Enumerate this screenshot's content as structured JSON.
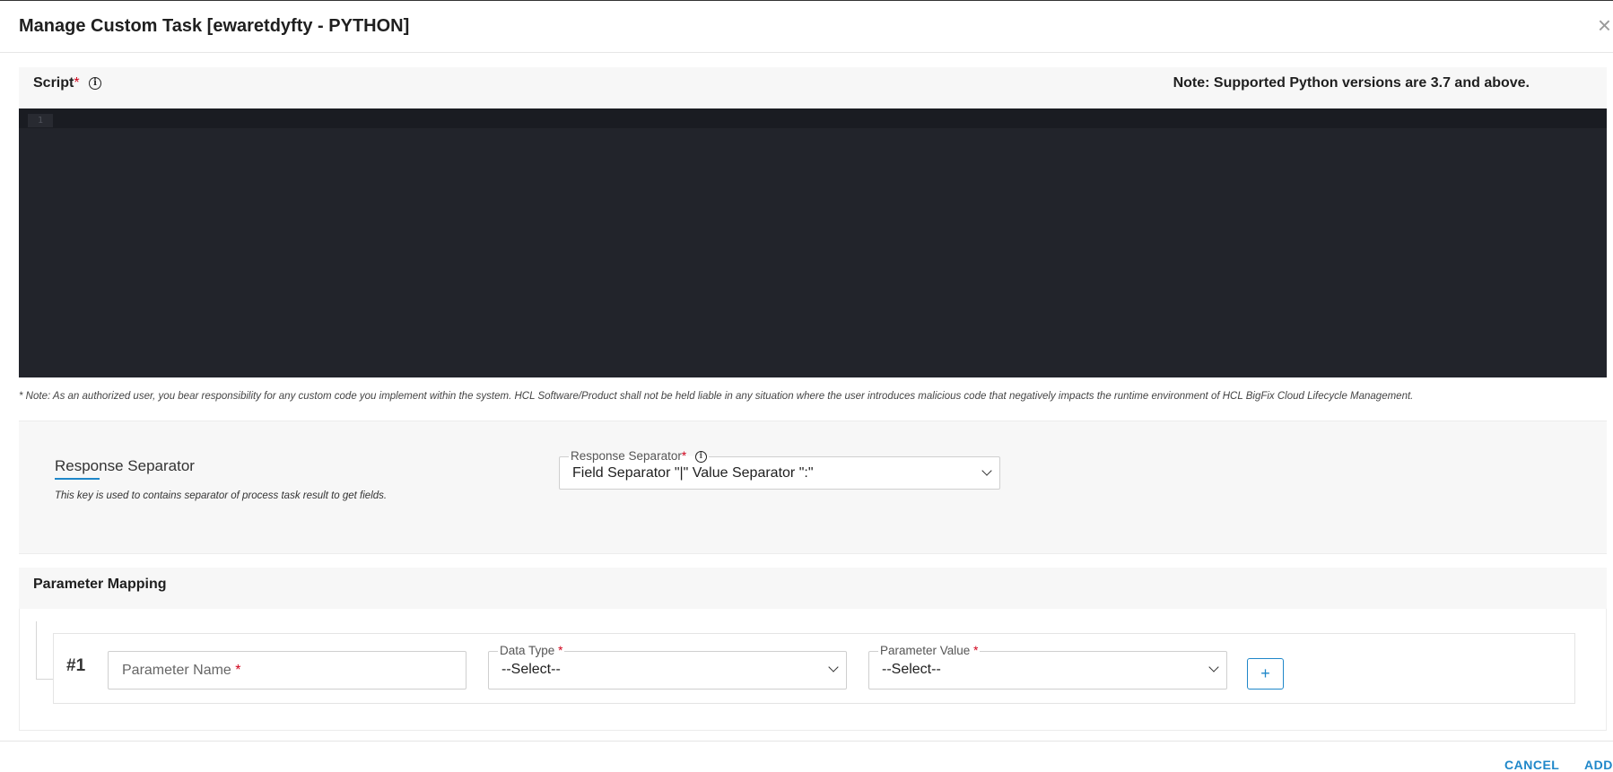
{
  "header": {
    "title": "Manage Custom Task [ewaretdyfty - PYTHON]",
    "close_glyph": "×",
    "close_icon": "close-icon"
  },
  "script": {
    "label": "Script",
    "required_mark": "*",
    "info_glyph": "i",
    "note": "Note: Supported Python versions are 3.7 and above.",
    "editor": {
      "line_numbers": [
        "1"
      ],
      "code": ""
    },
    "disclaimer": "* Note: As an authorized user, you bear responsibility for any custom code you implement within the system. HCL Software/Product shall not be held liable in any situation where the user introduces malicious code that negatively impacts the runtime environment of HCL BigFix Cloud Lifecycle Management."
  },
  "response_separator": {
    "title": "Response Separator",
    "description": "This key is used to contains separator of process task result to get fields.",
    "field": {
      "label": "Response Separator",
      "required_mark": "*",
      "info_glyph": "i",
      "value": "Field Separator \"|\" Value Separator \":\""
    }
  },
  "parameter_mapping": {
    "title": "Parameter Mapping",
    "rows": [
      {
        "number": "#1",
        "name_placeholder": "Parameter Name",
        "name_required_mark": "*",
        "data_type": {
          "label": "Data Type",
          "required_mark": "*",
          "value": "--Select--"
        },
        "parameter_value": {
          "label": "Parameter Value",
          "required_mark": "*",
          "value": "--Select--"
        },
        "add_glyph": "+"
      }
    ]
  },
  "footer": {
    "cancel_label": "CANCEL",
    "add_label": "ADD"
  },
  "colors": {
    "accent": "#1f87c9",
    "required": "#d0021b",
    "editor_bg": "#22242b"
  }
}
